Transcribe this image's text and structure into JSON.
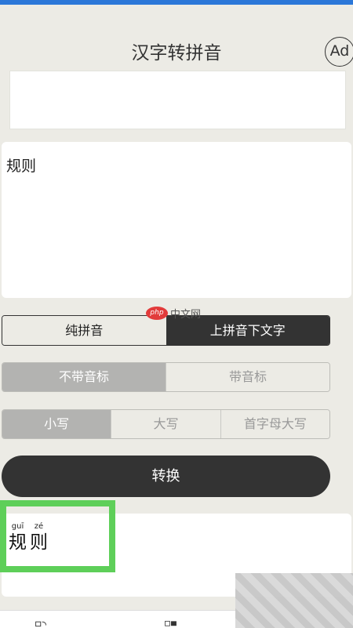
{
  "header": {
    "title": "汉字转拼音",
    "ad_badge": "Ad"
  },
  "input": {
    "text": "规则"
  },
  "watermark": {
    "logo": "php",
    "text": "中文网"
  },
  "mode_toggle": {
    "options": [
      "纯拼音",
      "上拼音下文字"
    ],
    "selected": "上拼音下文字"
  },
  "tone_toggle": {
    "options": [
      "不带音标",
      "带音标"
    ],
    "selected": "不带音标"
  },
  "case_toggle": {
    "options": [
      "小写",
      "大写",
      "首字母大写"
    ],
    "selected": "小写"
  },
  "convert_button": {
    "label": "转换"
  },
  "result": {
    "chars": [
      {
        "pinyin": "guī",
        "hanzi": "规"
      },
      {
        "pinyin": "zé",
        "hanzi": "则"
      }
    ]
  },
  "colors": {
    "highlight": "#5ecf59",
    "dark": "#333333",
    "background": "#ecebe5"
  },
  "bottom_nav": {
    "icons": [
      "tab-icon-1",
      "tab-icon-2"
    ]
  }
}
